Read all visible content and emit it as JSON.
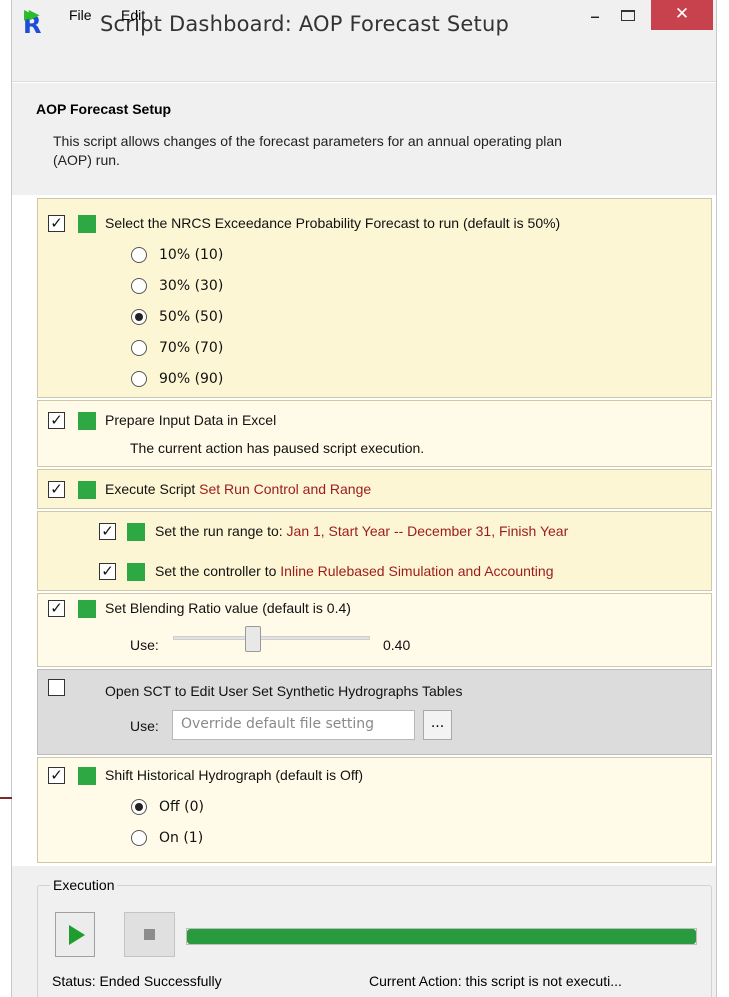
{
  "window": {
    "title": "Script Dashboard: AOP Forecast Setup",
    "app_icon": "riverware-logo-icon",
    "minimize_glyph": "–",
    "close_glyph": "✕"
  },
  "menu": {
    "file": "File",
    "edit": "Edit",
    "run_icon": "fast-forward-icon"
  },
  "header": {
    "title": "AOP Forecast Setup",
    "description": "This script allows changes of the forecast parameters for an annual operating plan (AOP) run."
  },
  "check_glyph": "✓",
  "forecast": {
    "label": "Select the NRCS Exceedance Probability Forecast to run (default is  50%)",
    "checked": true,
    "options": [
      {
        "label": "10% (10)",
        "selected": false
      },
      {
        "label": "30% (30)",
        "selected": false
      },
      {
        "label": "50% (50)",
        "selected": true
      },
      {
        "label": "70% (70)",
        "selected": false
      },
      {
        "label": "90% (90)",
        "selected": false
      }
    ]
  },
  "prepare": {
    "label": "Prepare Input Data in Excel",
    "message": "The current action has paused script execution.",
    "checked": true
  },
  "execute": {
    "label": "Execute Script",
    "script_name": "Set Run Control and Range",
    "checked": true,
    "run_range": {
      "label": "Set the run range to:",
      "value": "Jan 1, Start Year -- December 31, Finish Year",
      "checked": true
    },
    "controller": {
      "label": "Set the controller to",
      "value": "Inline Rulebased Simulation and Accounting",
      "checked": true
    }
  },
  "blending": {
    "label": "Set Blending Ratio value (default is 0.4)",
    "use_label": "Use:",
    "value": "0.40",
    "slider_fraction": 0.4,
    "checked": true
  },
  "sct": {
    "label": "Open SCT to Edit User Set Synthetic Hydrographs Tables",
    "use_label": "Use:",
    "placeholder": "Override default file setting",
    "browse_label": "...",
    "checked": false
  },
  "shift": {
    "label": "Shift Historical Hydrograph (default is Off)",
    "checked": true,
    "options": [
      {
        "label": "Off (0)",
        "selected": true
      },
      {
        "label": "On (1)",
        "selected": false
      }
    ]
  },
  "execution": {
    "title": "Execution",
    "status": "Status:  Ended Successfully",
    "current_action": "Current Action:  this script is not executi...",
    "progress": 1.0,
    "colors": {
      "progress": "#2a9a3e",
      "play": "#1e9c2e"
    }
  },
  "colors": {
    "accent_green": "#2ea843",
    "value_red": "#9c1c1c",
    "panel_yellow": "#fdf6d4"
  }
}
